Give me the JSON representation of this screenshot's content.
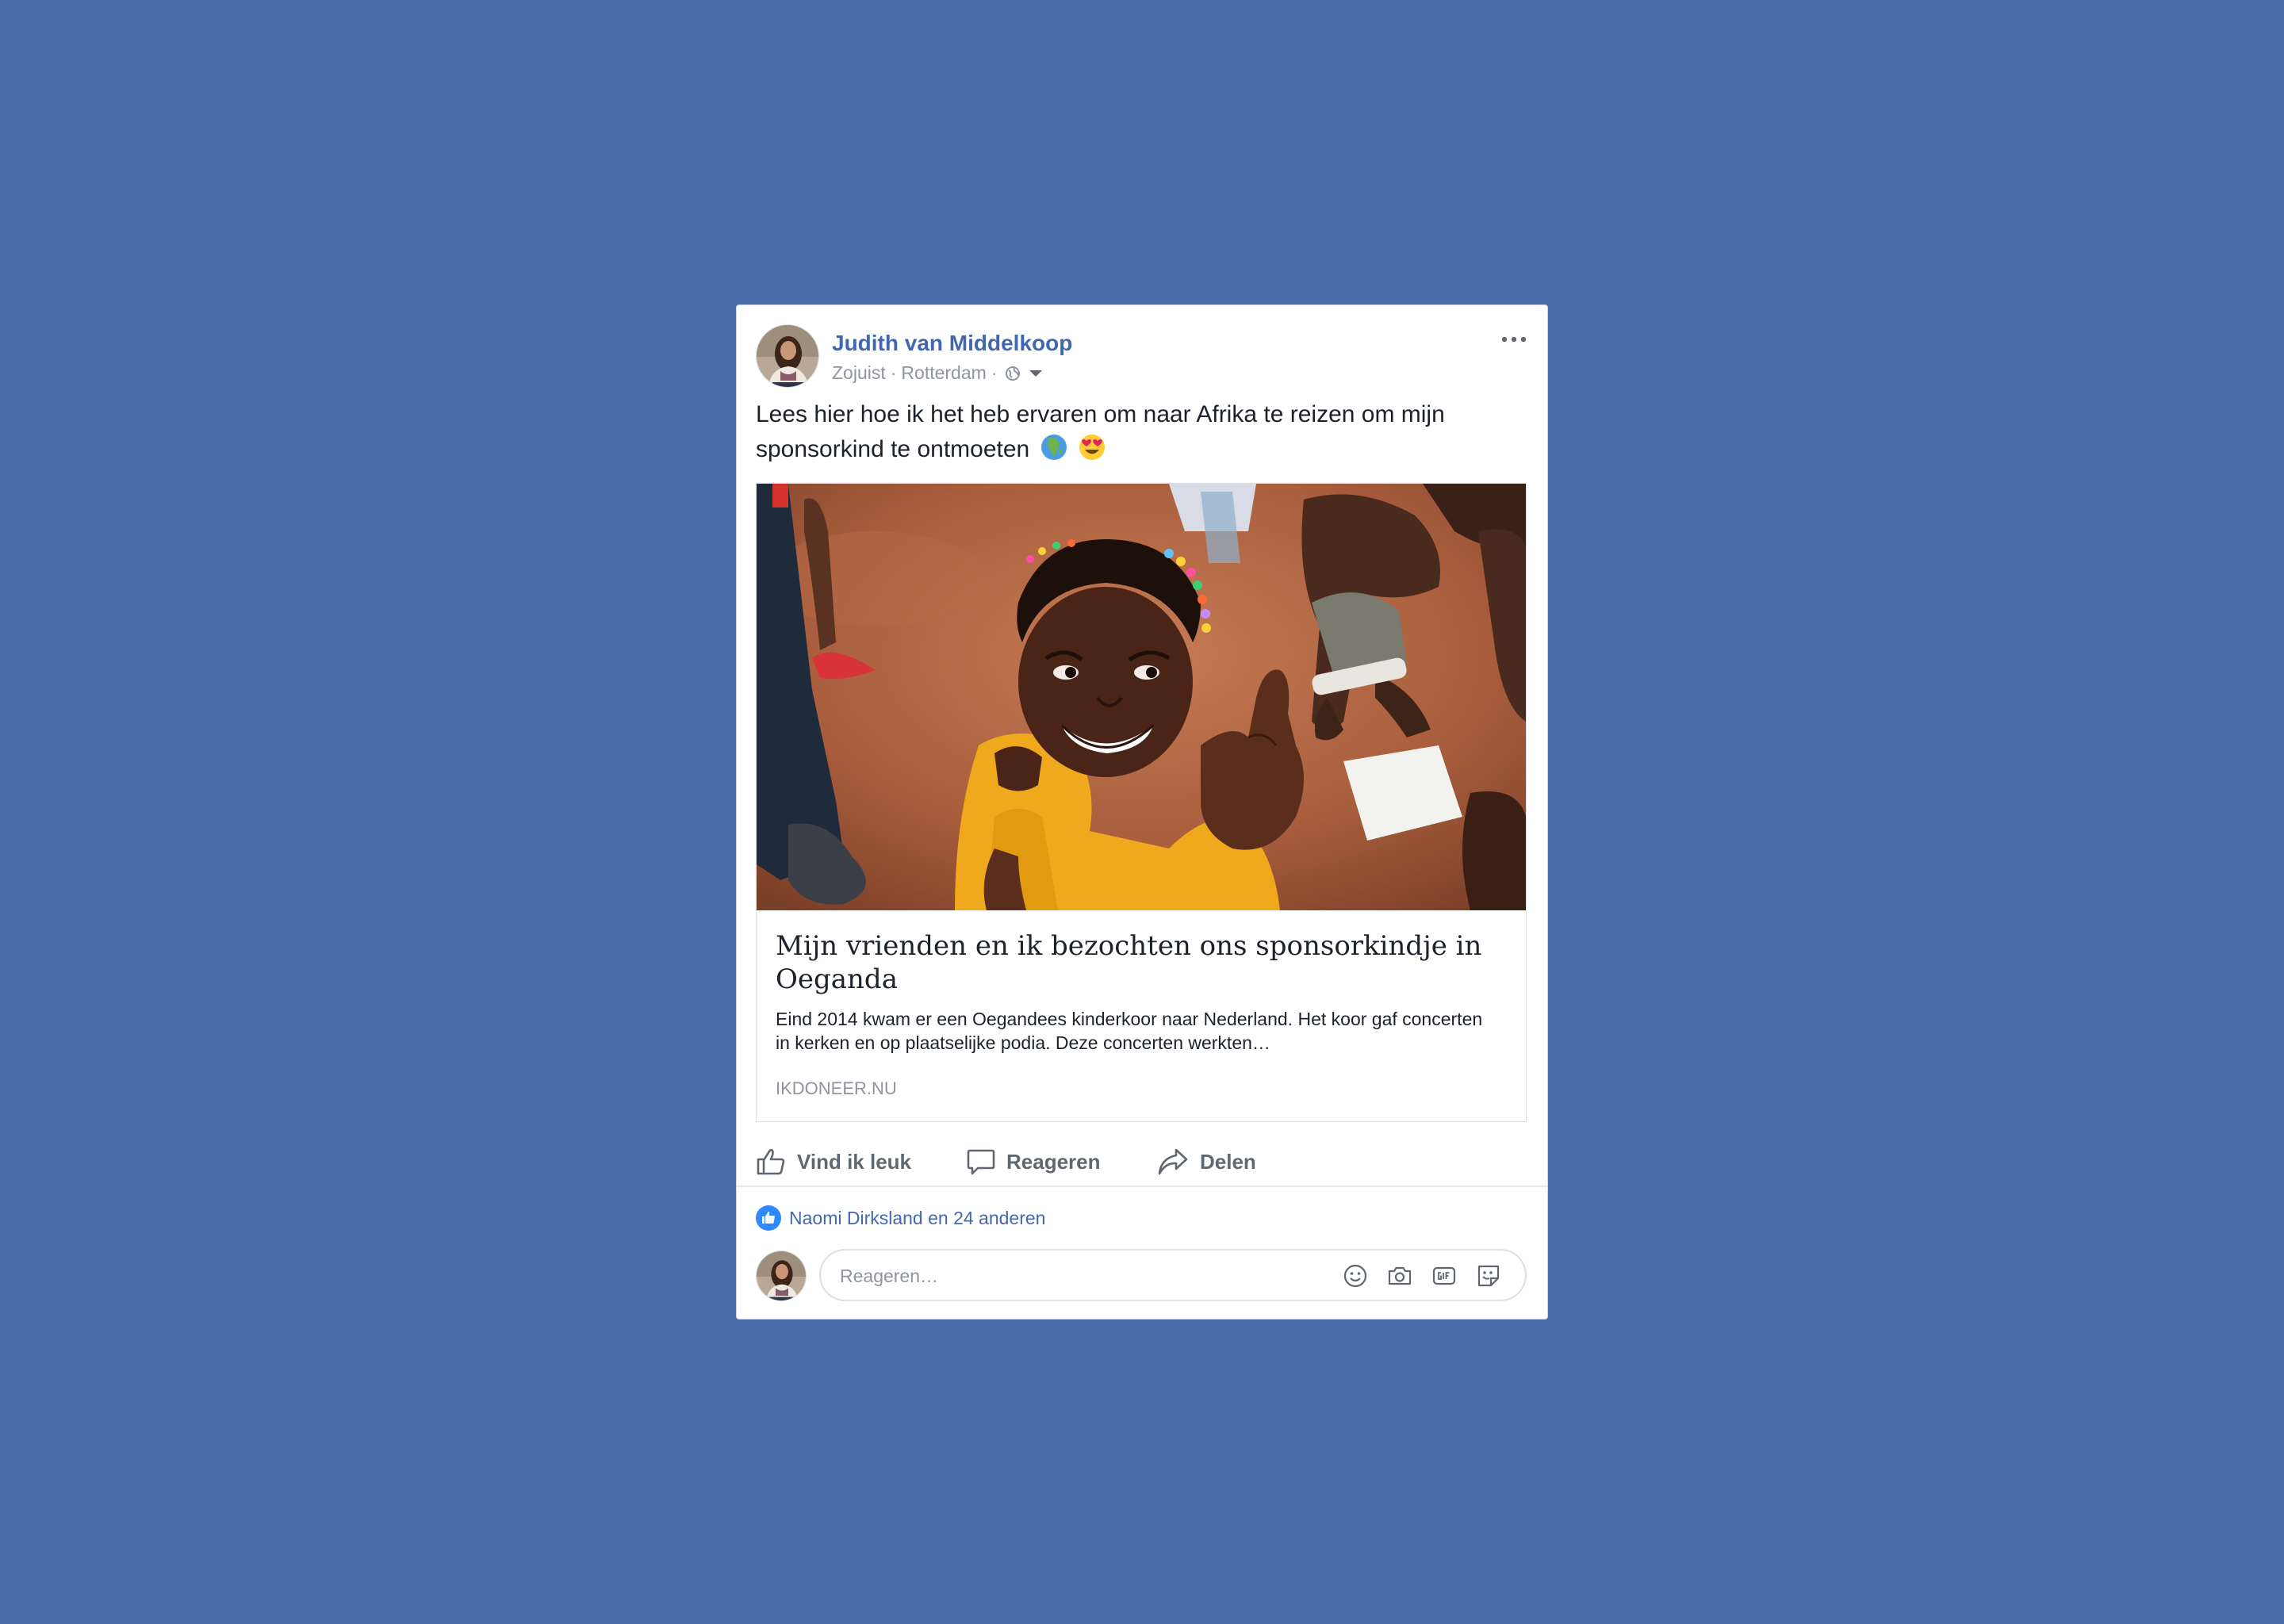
{
  "post": {
    "author": "Judith van Middelkoop",
    "time": "Zojuist",
    "location": "Rotterdam",
    "meta_separator": "·",
    "text": "Lees hier hoe ik het heb ervaren om naar Afrika te reizen om mijn sponsorkind te ontmoeten",
    "emojis": [
      "globe-africa-emoji",
      "heart-eyes-emoji"
    ],
    "privacy_icon": "globe-icon",
    "menu_icon": "more-options-icon"
  },
  "link_preview": {
    "title": "Mijn vrienden en ik bezochten ons sponsorkindje in Oeganda",
    "description": "Eind 2014 kwam er een Oegandees kinderkoor naar Nederland. Het koor gaf concerten in kerken en op plaatselijke podia. Deze concerten werkten…",
    "domain": "IKDONEER.NU",
    "image": "photo-smiling-child"
  },
  "actions": {
    "like": "Vind ik leuk",
    "comment": "Reageren",
    "share": "Delen"
  },
  "likes": {
    "text": "Naomi Dirksland en 24 anderen"
  },
  "comment": {
    "placeholder": "Reageren…",
    "buttons": [
      "emoji-icon",
      "camera-icon",
      "gif-icon",
      "sticker-icon"
    ]
  },
  "colors": {
    "background": "#4a6ea9",
    "brand_link": "#4267b2",
    "muted": "#90949c"
  }
}
